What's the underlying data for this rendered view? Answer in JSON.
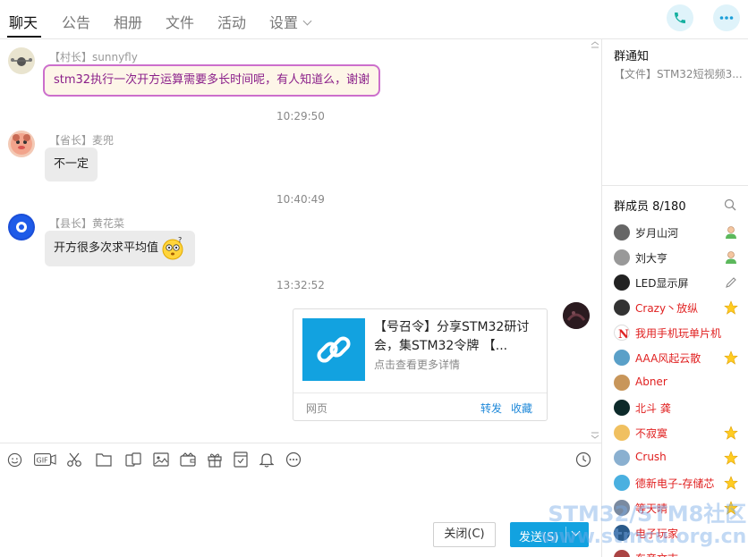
{
  "tabs": [
    {
      "label": "聊天",
      "active": true
    },
    {
      "label": "公告"
    },
    {
      "label": "相册"
    },
    {
      "label": "文件"
    },
    {
      "label": "活动"
    },
    {
      "label": "设置"
    }
  ],
  "messages": [
    {
      "sender": "【村长】sunnyfly",
      "text": "stm32执行一次开方运算需要多长时间呢，有人知道么，谢谢"
    },
    {
      "time": "10:29:50"
    },
    {
      "sender": "【省长】麦兜",
      "text": "不一定"
    },
    {
      "time": "10:40:49"
    },
    {
      "sender": "【县长】黄花菜",
      "text": "开方很多次求平均值"
    },
    {
      "time": "13:32:52"
    }
  ],
  "share_card": {
    "title": "【号召令】分享STM32研讨会，集STM32令牌 【...",
    "subtitle": "点击查看更多详情",
    "source": "网页",
    "forward": "转发",
    "favorite": "收藏"
  },
  "input": {
    "gif_label": "GIF",
    "close_label": "关闭(C)",
    "send_label": "发送(S)"
  },
  "notice": {
    "title": "群通知",
    "text": "【文件】STM32短视频3..."
  },
  "members": {
    "title": "群成员 8/180",
    "list": [
      {
        "name": "岁月山河",
        "color": "#222222",
        "badge": "person-icon"
      },
      {
        "name": "刘大亨",
        "color": "#222222",
        "badge": "person-icon"
      },
      {
        "name": "LED显示屏",
        "color": "#222222",
        "badge": "pencil-icon"
      },
      {
        "name": "Crazy丶放纵",
        "color": "#e02020",
        "badge": "star-icon"
      },
      {
        "name": "我用手机玩单片机",
        "color": "#e02020",
        "badge": ""
      },
      {
        "name": "AAA风起云散",
        "color": "#e02020",
        "badge": "star-icon"
      },
      {
        "name": "Abner",
        "color": "#e02020",
        "badge": ""
      },
      {
        "name": "北斗 龚",
        "color": "#e02020",
        "badge": ""
      },
      {
        "name": "不寂寞",
        "color": "#e02020",
        "badge": "star-icon"
      },
      {
        "name": "Crush",
        "color": "#e02020",
        "badge": "star-icon"
      },
      {
        "name": "德新电子-存储芯",
        "color": "#e02020",
        "badge": "star-icon"
      },
      {
        "name": "等天晴",
        "color": "#e02020",
        "badge": "star-icon"
      },
      {
        "name": "电子玩家",
        "color": "#e02020",
        "badge": ""
      },
      {
        "name": "东帝文志",
        "color": "#e02020",
        "badge": ""
      }
    ]
  },
  "watermark": {
    "line1": "STM32/STM8社区",
    "line2": "www.stmcu.org.cn"
  }
}
